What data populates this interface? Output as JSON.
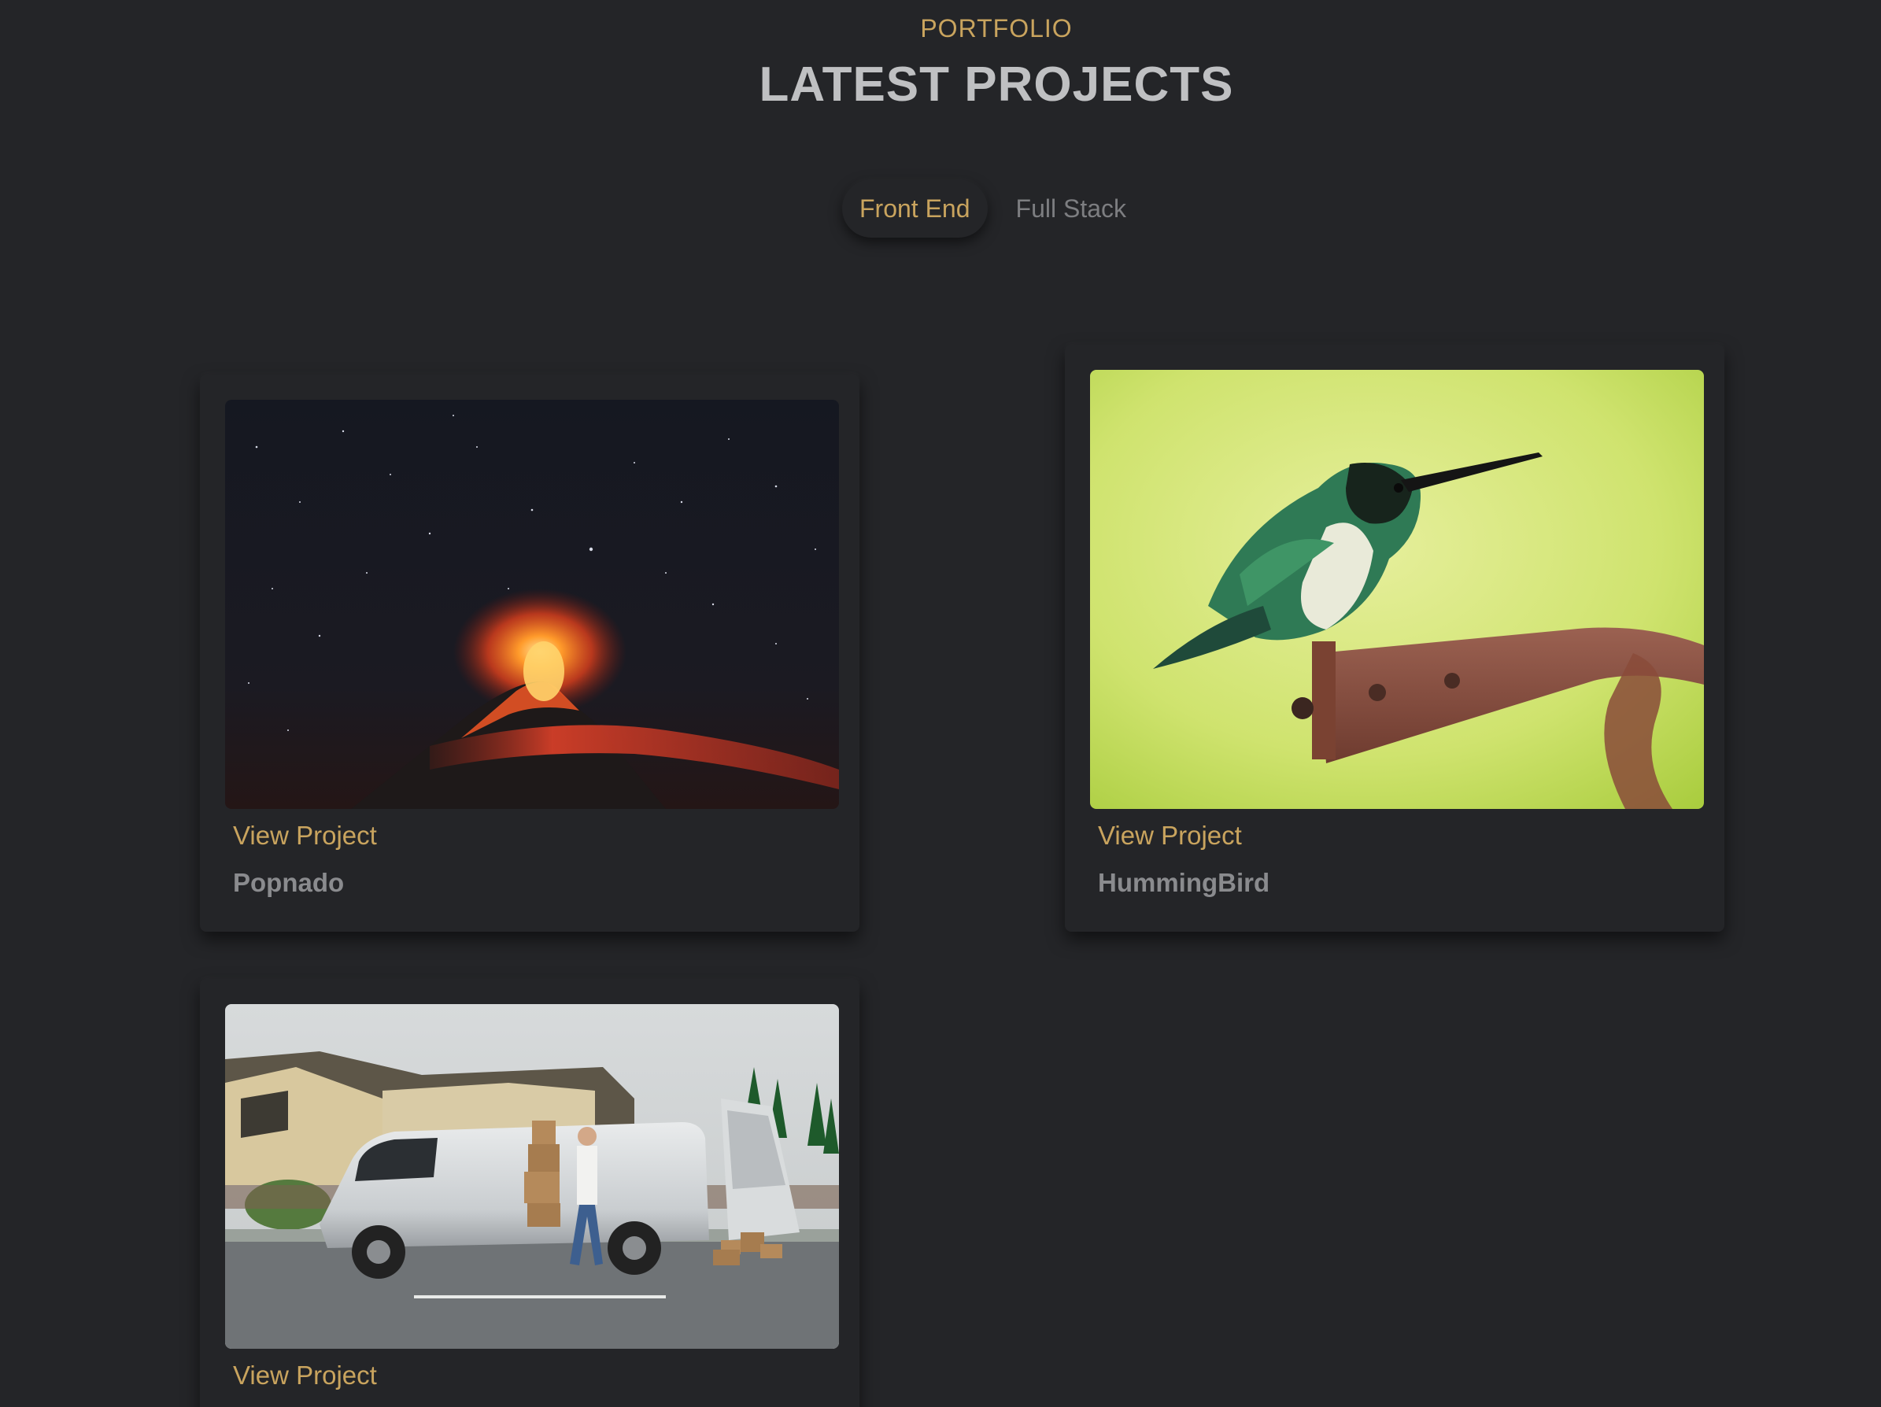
{
  "header": {
    "eyebrow": "PORTFOLIO",
    "title": "LATEST PROJECTS"
  },
  "tabs": [
    {
      "label": "Front End",
      "active": true
    },
    {
      "label": "Full Stack",
      "active": false
    }
  ],
  "projects": [
    {
      "link_label": "View Project",
      "name": "Popnado",
      "image": "volcano-night-sky"
    },
    {
      "link_label": "View Project",
      "name": "HummingBird",
      "image": "hummingbird-on-rusty-bracket"
    },
    {
      "link_label": "View Project",
      "name": "",
      "image": "delivery-van-with-boxes"
    }
  ],
  "colors": {
    "background": "#242528",
    "accent": "#c9a45e",
    "title": "#bfc0c2",
    "muted": "#7d7e81"
  }
}
